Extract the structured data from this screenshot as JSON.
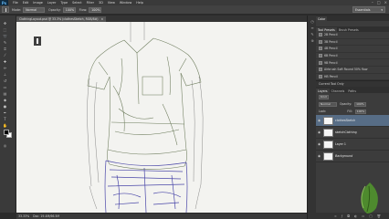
{
  "app": {
    "logo": "Ps"
  },
  "menu": [
    "File",
    "Edit",
    "Image",
    "Layer",
    "Type",
    "Select",
    "Filter",
    "3D",
    "View",
    "Window",
    "Help"
  ],
  "window_controls": [
    "–",
    "□",
    "×"
  ],
  "options": {
    "mode_label": "Mode:",
    "mode_value": "Normal",
    "opacity_label": "Opacity:",
    "opacity_value": "100%",
    "flow_label": "Flow:",
    "flow_value": "100%",
    "workspace": "Essentials"
  },
  "document_tab": {
    "title": "ClothingLayout.psd @ 33.3% (clothesSketch, RGB/8#)",
    "close": "×"
  },
  "status": {
    "zoom": "33.33%",
    "doc": "Doc: 19.4M/66.5M"
  },
  "panels": {
    "color_tab": "Color",
    "preset_tabs": [
      "Tool Presets",
      "Brush Presets"
    ],
    "presets": [
      "2B Pencil",
      "3B Pencil",
      "4B Pencil",
      "6B Pencil",
      "9B Pencil",
      "Airbrush Soft Round 50% flow",
      "HB Pencil"
    ],
    "current_tool": "Current Tool Only",
    "layer_tabs": [
      "Layers",
      "Channels",
      "Paths"
    ],
    "kind_label": "Kind",
    "blend_mode": "Normal",
    "opacity_label": "Opacity:",
    "opacity_value": "100%",
    "fill_label": "Fill:",
    "fill_value": "100%",
    "lock_label": "Lock:"
  },
  "layers": [
    {
      "name": "clothesSketch",
      "selected": true,
      "italic": false
    },
    {
      "name": "sketchClothing",
      "selected": false,
      "italic": false
    },
    {
      "name": "Layer 1",
      "selected": false,
      "italic": false
    },
    {
      "name": "Background",
      "selected": false,
      "italic": true
    }
  ],
  "colors": {
    "accent": "#576d86",
    "canvas": "#f3f3f0",
    "brand_leaf": "#4e8a2e"
  }
}
